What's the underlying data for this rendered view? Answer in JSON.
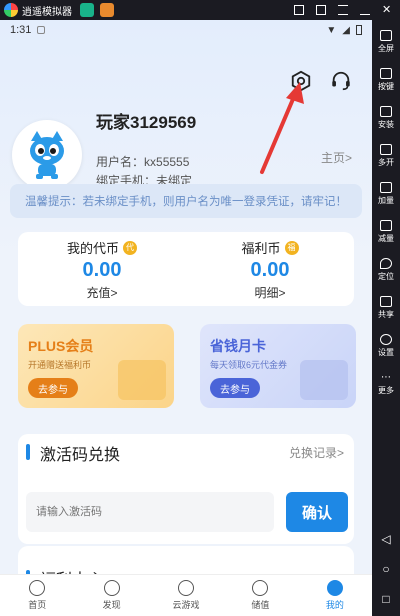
{
  "emulator": {
    "title": "逍遥模拟器",
    "sidebar": [
      {
        "label": "全屏",
        "icon": "fullscreen-icon"
      },
      {
        "label": "按键",
        "icon": "keyboard-icon"
      },
      {
        "label": "安装",
        "icon": "apk-icon"
      },
      {
        "label": "多开",
        "icon": "multi-instance-icon"
      },
      {
        "label": "加量",
        "icon": "volume-up-icon"
      },
      {
        "label": "减量",
        "icon": "volume-down-icon"
      },
      {
        "label": "定位",
        "icon": "location-icon"
      },
      {
        "label": "共享",
        "icon": "folder-share-icon"
      },
      {
        "label": "设置",
        "icon": "gear-icon"
      },
      {
        "label": "更多",
        "icon": "more-icon"
      }
    ]
  },
  "status": {
    "time": "1:31"
  },
  "profile": {
    "nickname": "玩家3129569",
    "username_label": "用户名：",
    "username": "kx55555",
    "phone_label": "绑定手机：",
    "phone": "未绑定",
    "home_link": "主页>"
  },
  "tip": "温馨提示：若未绑定手机，则用户名为唯一登录凭证，请牢记！",
  "wallet": {
    "my_coins": {
      "label": "我的代币",
      "badge": "代",
      "value": "0.00",
      "link": "充值>"
    },
    "welfare_coins": {
      "label": "福利币",
      "badge": "福",
      "value": "0.00",
      "link": "明细>"
    }
  },
  "promos": {
    "plus": {
      "title": "PLUS会员",
      "subtitle": "开通赠送福利币",
      "button": "去参与",
      "color": "#e57f18"
    },
    "card": {
      "title": "省钱月卡",
      "subtitle": "每天领取6元代金券",
      "button": "去参与",
      "color": "#4a64d8"
    }
  },
  "redeem": {
    "title": "激活码兑换",
    "records": "兑换记录>",
    "placeholder": "请输入激活码",
    "confirm": "确认"
  },
  "welfare_center": {
    "title": "福利中心"
  },
  "tabs": [
    {
      "label": "首页",
      "icon": "home-icon",
      "active": false
    },
    {
      "label": "发现",
      "icon": "planet-icon",
      "active": false
    },
    {
      "label": "云游戏",
      "icon": "cloud-icon",
      "active": false
    },
    {
      "label": "储值",
      "icon": "yen-icon",
      "active": false
    },
    {
      "label": "我的",
      "icon": "user-icon",
      "active": true
    }
  ],
  "colors": {
    "accent": "#1e88e5",
    "annotation": "#e53935"
  }
}
